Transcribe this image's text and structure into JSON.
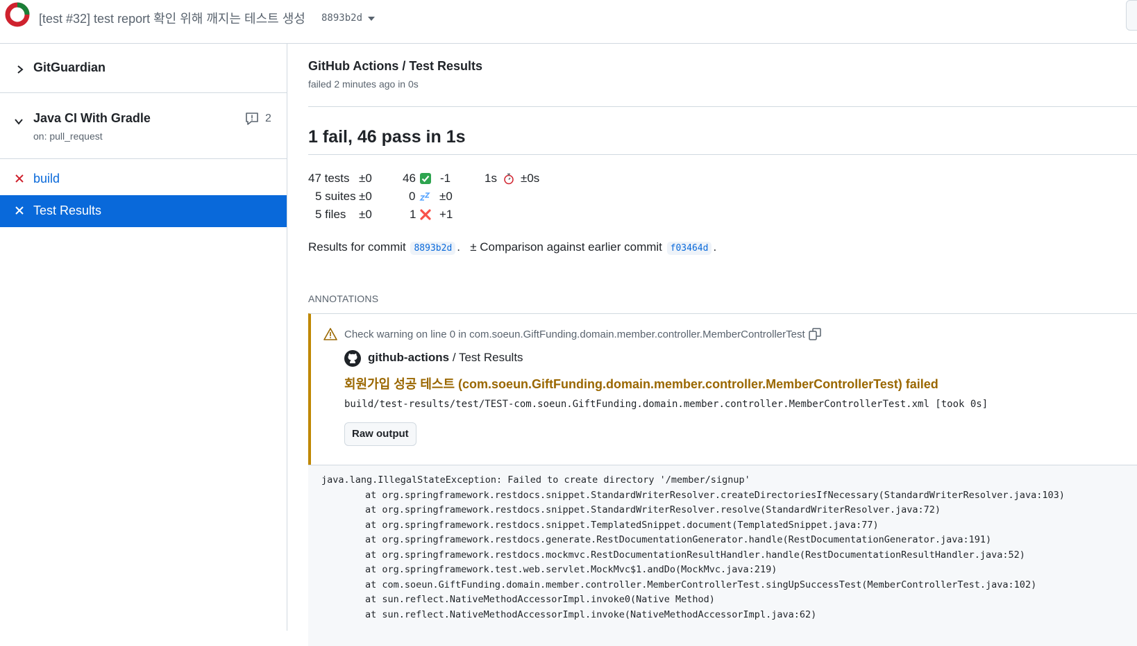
{
  "header": {
    "title": "[test #32] test report 확인 위해 깨지는 테스트 생성",
    "sha": "8893b2d",
    "status_colors": {
      "success": "#1a7f37",
      "failure": "#cf222e"
    }
  },
  "sidebar": {
    "groups": [
      {
        "name": "GitGuardian",
        "expanded": false
      },
      {
        "name": "Java CI With Gradle",
        "trigger": "on: pull_request",
        "expanded": true,
        "comment_count": "2"
      }
    ],
    "jobs": [
      {
        "label": "build",
        "status": "failed",
        "selected": false
      },
      {
        "label": "Test Results",
        "status": "failed",
        "selected": true
      }
    ]
  },
  "main": {
    "breadcrumb": "GitHub Actions / Test Results",
    "run_status": "failed 2 minutes ago in 0s",
    "summary_title": "1 fail, 46 pass in 1s",
    "stats": {
      "tests": "47 tests",
      "tests_delta": "±0",
      "suites": "5 suites",
      "suites_delta": "±0",
      "files": "5 files",
      "files_delta": "±0",
      "passed": "46",
      "passed_delta": "-1",
      "skipped": "0",
      "skipped_delta": "±0",
      "failed": "1",
      "failed_delta": "+1",
      "duration": "1s",
      "duration_delta": "±0s"
    },
    "commit_line": {
      "prefix": "Results for commit",
      "commit": "8893b2d",
      "middle": "± Comparison against earlier commit",
      "earlier_commit": "f03464d"
    },
    "annotations_heading": "ANNOTATIONS",
    "annotation": {
      "location": "Check warning on line 0 in com.soeun.GiftFunding.domain.member.controller.MemberControllerTest",
      "source_bold": "github-actions",
      "source_rest": " / Test Results",
      "message": "회원가입 성공 테스트 (com.soeun.GiftFunding.domain.member.controller.MemberControllerTest) failed",
      "file": "build/test-results/test/TEST-com.soeun.GiftFunding.domain.member.controller.MemberControllerTest.xml [took 0s]",
      "raw_output_label": "Raw output"
    },
    "trace": [
      "java.lang.IllegalStateException: Failed to create directory '/member/signup'",
      "\tat org.springframework.restdocs.snippet.StandardWriterResolver.createDirectoriesIfNecessary(StandardWriterResolver.java:103)",
      "\tat org.springframework.restdocs.snippet.StandardWriterResolver.resolve(StandardWriterResolver.java:72)",
      "\tat org.springframework.restdocs.snippet.TemplatedSnippet.document(TemplatedSnippet.java:77)",
      "\tat org.springframework.restdocs.generate.RestDocumentationGenerator.handle(RestDocumentationGenerator.java:191)",
      "\tat org.springframework.restdocs.mockmvc.RestDocumentationResultHandler.handle(RestDocumentationResultHandler.java:52)",
      "\tat org.springframework.test.web.servlet.MockMvc$1.andDo(MockMvc.java:219)",
      "\tat com.soeun.GiftFunding.domain.member.controller.MemberControllerTest.singUpSuccessTest(MemberControllerTest.java:102)",
      "\tat sun.reflect.NativeMethodAccessorImpl.invoke0(Native Method)",
      "\tat sun.reflect.NativeMethodAccessorImpl.invoke(NativeMethodAccessorImpl.java:62)"
    ]
  }
}
